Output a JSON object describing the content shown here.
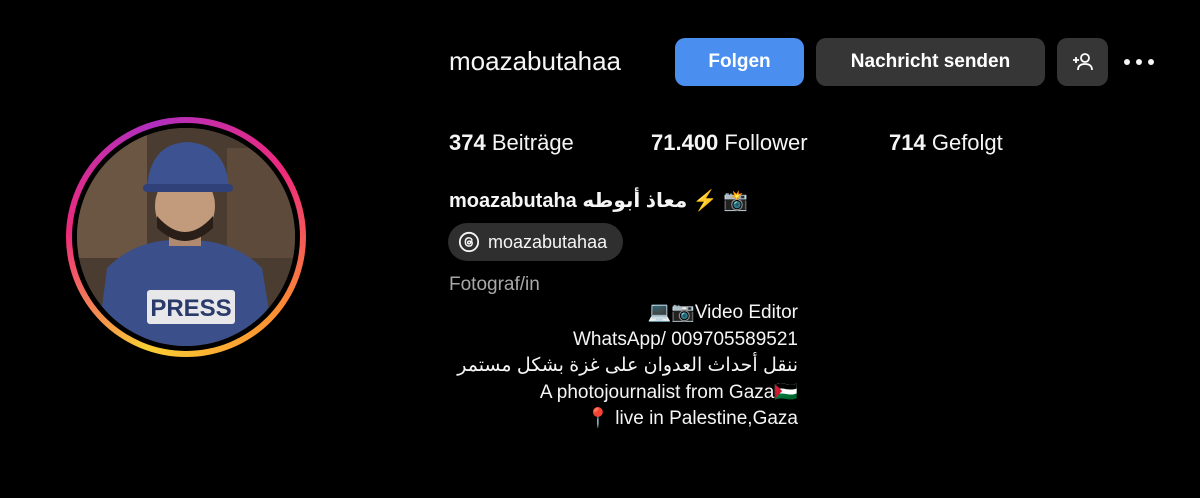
{
  "profile": {
    "username": "moazabutahaa",
    "full_name": "moazabutaha معاذ أبوطه ⚡️ 📸",
    "avatar_text": "PRESS"
  },
  "actions": {
    "follow_label": "Folgen",
    "message_label": "Nachricht senden"
  },
  "stats": {
    "posts_count": "374",
    "posts_label": "Beiträge",
    "followers_count": "71.400",
    "followers_label": "Follower",
    "following_count": "714",
    "following_label": "Gefolgt"
  },
  "threads": {
    "handle": "moazabutahaa"
  },
  "category": "Fotograf/in",
  "bio": {
    "line1": "💻📷Video Editor",
    "line2": "WhatsApp/ 009705589521",
    "line3": "ننقل أحداث العدوان على غزة بشكل مستمر",
    "line4": "A photojournalist from Gaza🇵🇸",
    "line5": "📍 live in Palestine,Gaza"
  },
  "colors": {
    "background": "#000000",
    "follow_button": "#4a8ff0",
    "secondary_button": "#363636",
    "muted_text": "#a8a8a8"
  }
}
